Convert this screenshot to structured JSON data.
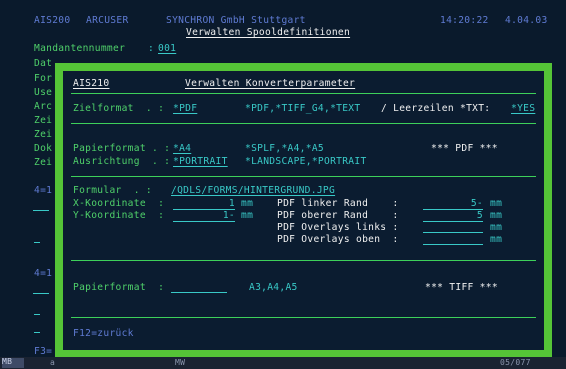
{
  "header": {
    "system": "AIS200",
    "user": "ARCUSER",
    "company": "SYNCHRON GmbH Stuttgart",
    "title": "Verwalten Spooldefinitionen",
    "time": "14:20:22",
    "date": "4.04.03"
  },
  "background": {
    "mandant_label": "Mandantennummer",
    "mandant_colon": ":",
    "mandant_value": "001",
    "labels": [
      "Dat",
      "For",
      "Use",
      "Arc",
      "Zei",
      "Zei",
      "Dok",
      "Zei"
    ],
    "left_fragments": [
      "4=1",
      "4=1",
      "F3="
    ]
  },
  "popup": {
    "program": "AIS210",
    "title": "Verwalten Konverterparameter",
    "zielformat_label": "Zielformat  . :",
    "zielformat_value": "*PDF",
    "zielformat_options": "*PDF,*TIFF_G4,*TEXT",
    "leerzeilen_label": "/ Leerzeilen *TXT:",
    "leerzeilen_value": "*YES",
    "papierformat_label": "Papierformat . :",
    "papierformat_value": "*A4",
    "papierformat_options": "*SPLF,*A4,*A5",
    "pdf_header": "*** PDF ***",
    "ausrichtung_label": "Ausrichtung  . :",
    "ausrichtung_value": "*PORTRAIT",
    "ausrichtung_options": "*LANDSCAPE,*PORTRAIT",
    "formular_label": "Formular  . :",
    "formular_value": "/QDLS/FORMS/HINTERGRUND.JPG",
    "xkoord_label": "X-Koordinate  :",
    "xkoord_value": "1",
    "ykoord_label": "Y-Koordinate  :",
    "ykoord_value": "1-",
    "unit_mm": "mm",
    "pdf_linker_label": "PDF linker Rand    :",
    "pdf_linker_value": "5-",
    "pdf_oberer_label": "PDF oberer Rand    :",
    "pdf_oberer_value": "5",
    "pdf_overlays_links_label": "PDF Overlays links :",
    "pdf_overlays_oben_label": "PDF Overlays oben  :",
    "tiff_papierformat_label": "Papierformat  :",
    "tiff_papierformat_options": "A3,A4,A5",
    "tiff_header": "*** TIFF ***",
    "footer_key": "F12=zurück"
  },
  "statusbar": {
    "left": "MB",
    "arrow": "a",
    "mid": "MW",
    "right": "05/077"
  }
}
